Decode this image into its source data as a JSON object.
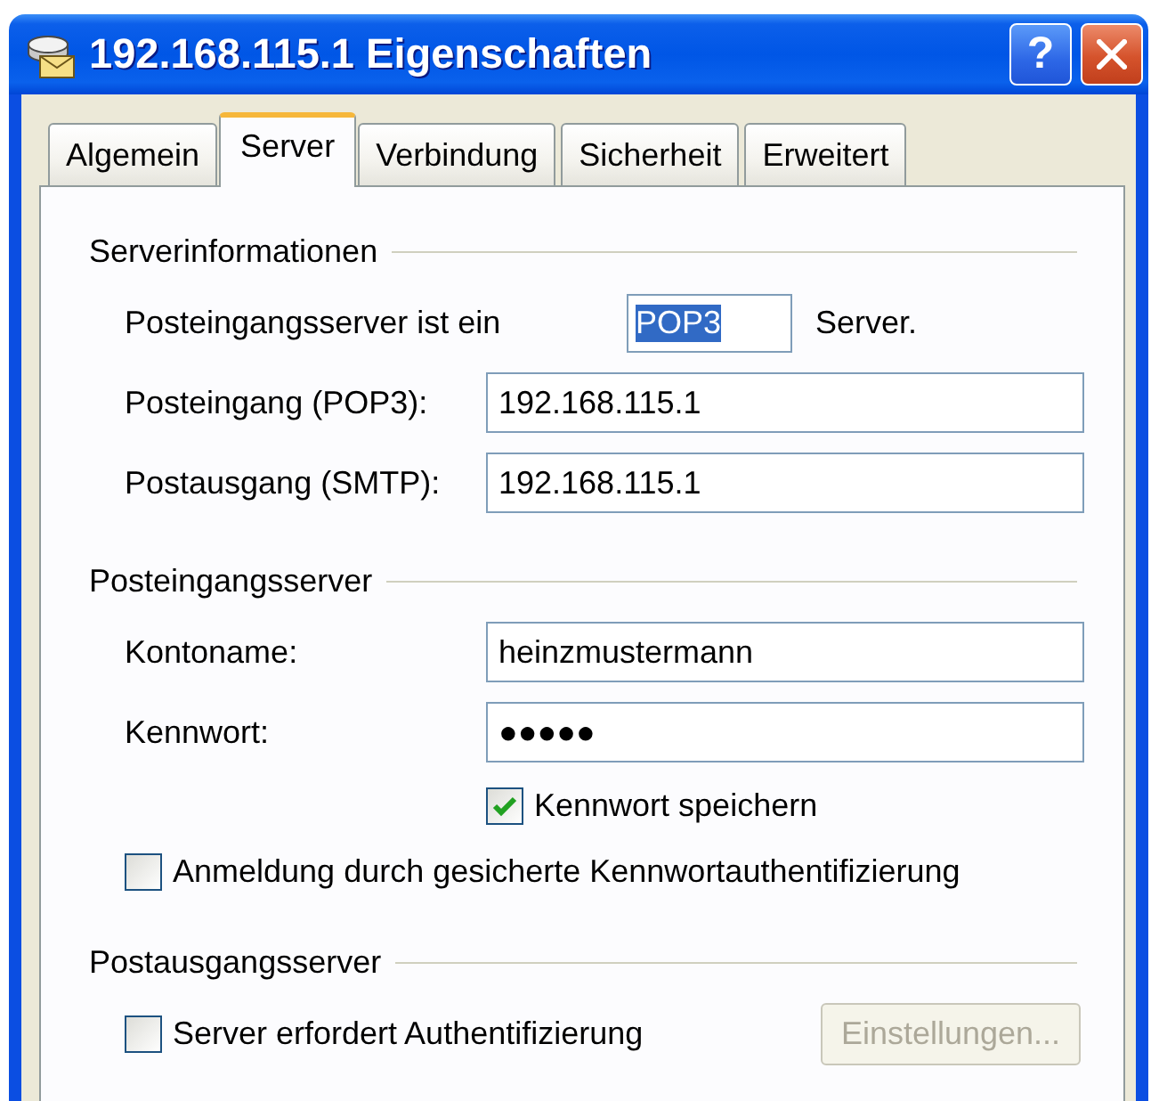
{
  "window": {
    "title": "192.168.115.1 Eigenschaften",
    "help_button": "?"
  },
  "tabs": [
    {
      "label": "Algemein",
      "selected": false
    },
    {
      "label": "Server",
      "selected": true
    },
    {
      "label": "Verbindung",
      "selected": false
    },
    {
      "label": "Sicherheit",
      "selected": false
    },
    {
      "label": "Erweitert",
      "selected": false
    }
  ],
  "server_information": {
    "title": "Serverinformationen",
    "server_type": {
      "label": "Posteingangsserver ist ein",
      "value": "POP3",
      "highlighted": true,
      "suffix": "Server."
    },
    "fields": [
      {
        "label": "Posteingang (POP3):",
        "value": "192.168.115.1"
      },
      {
        "label": "Postausgang (SMTP):",
        "value": "192.168.115.1"
      }
    ]
  },
  "incoming_server": {
    "title": "Posteingangsserver",
    "fields": [
      {
        "label": "Kontoname:",
        "value": "heinzmustermann"
      },
      {
        "label": "Kennwort:",
        "value": "●●●●●"
      }
    ],
    "save_password": {
      "label": "Kennwort speichern",
      "checked": true
    },
    "secure_authentication": {
      "label": "Anmeldung durch gesicherte Kennwortauthentifizierung",
      "checked": false
    }
  },
  "outgoing_server": {
    "title": "Postausgangsserver",
    "requires_authentication": {
      "label": "Server erfordert Authentifizierung",
      "checked": false
    },
    "settings_button": {
      "label": "Einstellungen...",
      "disabled": true
    }
  }
}
